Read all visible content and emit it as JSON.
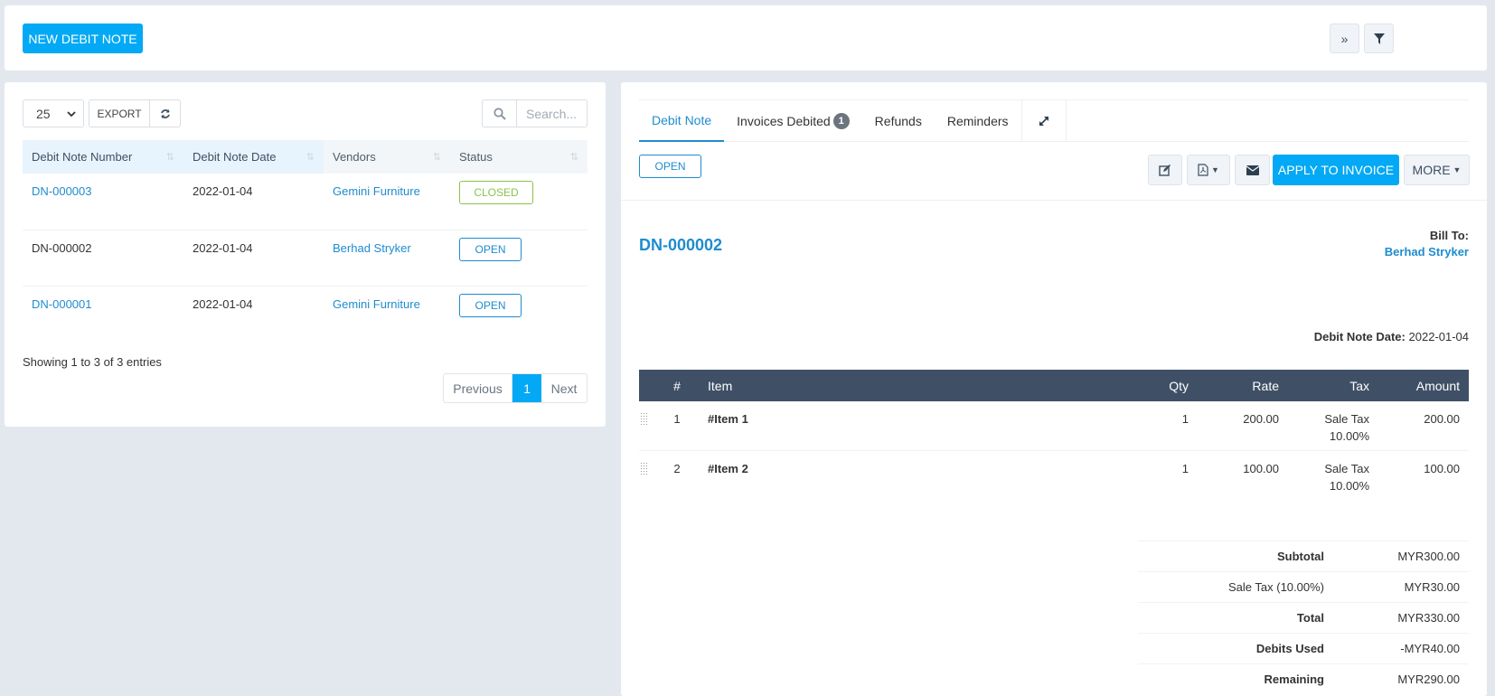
{
  "toolbar": {
    "new_button": "NEW DEBIT NOTE",
    "collapse_icon": "double-chevron-right-icon",
    "filter_icon": "filter-icon"
  },
  "list": {
    "page_length": "25",
    "export_label": "EXPORT",
    "search_placeholder": "Search...",
    "columns": [
      "Debit Note Number",
      "Debit Note Date",
      "Vendors",
      "Status"
    ],
    "rows": [
      {
        "number": "DN-000003",
        "date": "2022-01-04",
        "vendor": "Gemini Furniture",
        "status": "CLOSED"
      },
      {
        "number": "DN-000002",
        "date": "2022-01-04",
        "vendor": "Berhad Stryker",
        "status": "OPEN"
      },
      {
        "number": "DN-000001",
        "date": "2022-01-04",
        "vendor": "Gemini Furniture",
        "status": "OPEN"
      }
    ],
    "showing": "Showing 1 to 3 of 3 entries",
    "pagination": {
      "previous": "Previous",
      "current": "1",
      "next": "Next"
    }
  },
  "detail": {
    "tabs": [
      {
        "label": "Debit Note",
        "active": true
      },
      {
        "label": "Invoices Debited",
        "count": "1"
      },
      {
        "label": "Refunds"
      },
      {
        "label": "Reminders"
      }
    ],
    "status": "OPEN",
    "actions": {
      "apply": "APPLY TO INVOICE",
      "more": "MORE"
    },
    "number": "DN-000002",
    "bill_to_label": "Bill To:",
    "bill_to_vendor": "Berhad Stryker",
    "date_label": "Debit Note Date:",
    "date_value": "2022-01-04",
    "item_columns": [
      "#",
      "Item",
      "Qty",
      "Rate",
      "Tax",
      "Amount"
    ],
    "items": [
      {
        "no": "1",
        "item": "#Item 1",
        "qty": "1",
        "rate": "200.00",
        "tax_name": "Sale Tax",
        "tax_rate": "10.00%",
        "amount": "200.00"
      },
      {
        "no": "2",
        "item": "#Item 2",
        "qty": "1",
        "rate": "100.00",
        "tax_name": "Sale Tax",
        "tax_rate": "10.00%",
        "amount": "100.00"
      }
    ],
    "totals": [
      {
        "label": "Subtotal",
        "value": "MYR300.00"
      },
      {
        "label": "Sale Tax (10.00%)",
        "value": "MYR30.00"
      },
      {
        "label": "Total",
        "value": "MYR330.00"
      },
      {
        "label": "Debits Used",
        "value": "-MYR40.00"
      },
      {
        "label": "Remaining",
        "value": "MYR290.00"
      }
    ]
  },
  "colors": {
    "primary": "#03a9f4",
    "link": "#1e8ccf",
    "closed": "#8bc34a",
    "table_header": "#3f5066"
  }
}
